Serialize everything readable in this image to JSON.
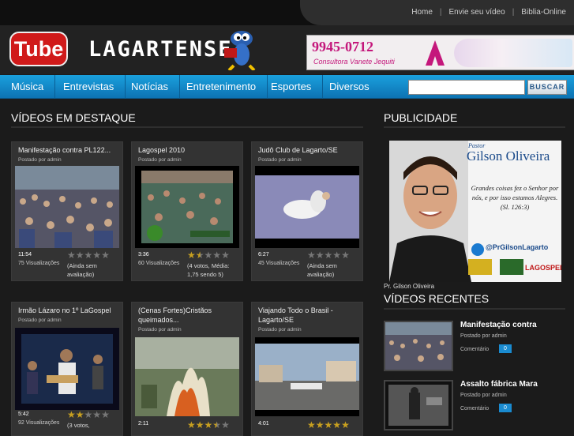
{
  "top_links": [
    "Home",
    "Envie seu vídeo",
    "Biblia-Online"
  ],
  "logo": {
    "tube": "Tube",
    "name": "LAGARTENSE"
  },
  "banner": {
    "phone": "9945-0712",
    "subtitle": "Consultora Vanete",
    "brand": "Jequiti"
  },
  "nav": [
    "Música",
    "Entrevistas",
    "Notícias",
    "Entretenimento",
    "Esportes",
    "Diversos"
  ],
  "search": {
    "button": "BUSCAR",
    "placeholder": ""
  },
  "sections": {
    "featured": "VÍDEOS EM DESTAQUE",
    "ads": "PUBLICIDADE",
    "recent": "VÍDEOS RECENTES"
  },
  "videos": [
    {
      "title": "Manifestação contra PL122...",
      "posted": "Postado por admin",
      "duration": "11:54",
      "views": "75 Visualizações",
      "stars": 0,
      "rating": "(Ainda sem avaliação)"
    },
    {
      "title": "Lagospel 2010",
      "posted": "Postado por admin",
      "duration": "3:36",
      "views": "60 Visualizações",
      "stars": 1.5,
      "rating": "(4 votos, Média: 1,75 sendo 5)"
    },
    {
      "title": "Judô Club de Lagarto/SE",
      "posted": "Postado por admin",
      "duration": "6:27",
      "views": "45 Visualizações",
      "stars": 0,
      "rating": "(Ainda sem avaliação)"
    },
    {
      "title": "Irmão Lázaro no 1º LaGospel",
      "posted": "Postado por admin",
      "duration": "5:42",
      "views": "92 Visualizações",
      "stars": 2,
      "rating": "(3 votos,"
    },
    {
      "title": "(Cenas Fortes)Cristãos queimados...",
      "posted": "Postado por admin",
      "duration": "2:11",
      "views": "",
      "stars": 3.5,
      "rating": ""
    },
    {
      "title": "Viajando Todo o Brasil - Lagarto/SE",
      "posted": "Postado por admin",
      "duration": "4:01",
      "views": "",
      "stars": 5,
      "rating": ""
    }
  ],
  "ad": {
    "name_line1": "Pastor",
    "name_line2": "Gilson Oliveira",
    "text": "Grandes coisas fez o Senhor por nós, e por isso estamos Alegres.",
    "ref": "(Sl. 126:3)",
    "handle": "@PrGilsonLagarto",
    "logo": "LAGOSPEL",
    "caption": "Pr. Gilson Oliveira"
  },
  "recent": [
    {
      "title": "Manifestação contra",
      "posted": "Postado por admin",
      "comments_label": "Comentário",
      "count": "0"
    },
    {
      "title": "Assalto fábrica Mara",
      "posted": "Postado por admin",
      "comments_label": "Comentário",
      "count": "0"
    }
  ],
  "colors": {
    "nav": "#1aa0dd",
    "star": "#c8a020",
    "badge": "#1a8bd0"
  }
}
